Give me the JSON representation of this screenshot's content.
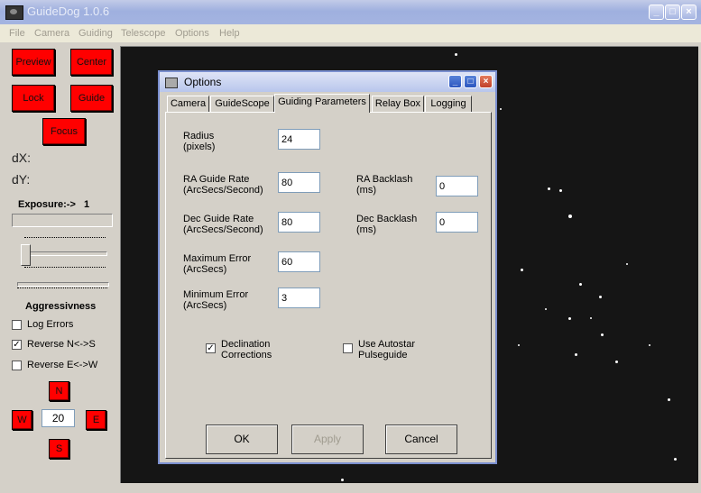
{
  "app": {
    "title": "GuideDog 1.0.6"
  },
  "menu": [
    "File",
    "Camera",
    "Guiding",
    "Telescope",
    "Options",
    "Help"
  ],
  "panel": {
    "buttons": {
      "preview": "Preview",
      "center": "Center",
      "lock": "Lock",
      "guide": "Guide",
      "focus": "Focus"
    },
    "dx_label": "dX:",
    "dy_label": "dY:",
    "exposure_label": "Exposure:->",
    "exposure_value": "1",
    "aggressiveness_label": "Aggressivness",
    "log_errors": {
      "label": "Log Errors",
      "checked": false
    },
    "reverse_ns": {
      "label": "Reverse N<->S",
      "checked": true
    },
    "reverse_ew": {
      "label": "Reverse E<->W",
      "checked": false
    },
    "nudge": {
      "n": "N",
      "w": "W",
      "e": "E",
      "s": "S",
      "value": "20"
    }
  },
  "dialog": {
    "title": "Options",
    "tabs": [
      "Camera",
      "GuideScope",
      "Guiding Parameters",
      "Relay Box",
      "Logging"
    ],
    "active_tab": "Guiding Parameters",
    "fields": {
      "radius": {
        "label1": "Radius",
        "label2": "(pixels)",
        "value": "24"
      },
      "ra_guide_rate": {
        "label1": "RA Guide Rate",
        "label2": "(ArcSecs/Second)",
        "value": "80"
      },
      "dec_guide_rate": {
        "label1": "Dec Guide Rate",
        "label2": "(ArcSecs/Second)",
        "value": "80"
      },
      "maximum_error": {
        "label1": "Maximum Error",
        "label2": "(ArcSecs)",
        "value": "60"
      },
      "minimum_error": {
        "label1": "Minimum Error",
        "label2": "(ArcSecs)",
        "value": "3"
      },
      "ra_backlash": {
        "label1": "RA Backlash",
        "label2": "(ms)",
        "value": "0"
      },
      "dec_backlash": {
        "label1": "Dec Backlash",
        "label2": "(ms)",
        "value": "0"
      }
    },
    "declination_corrections": {
      "label1": "Declination",
      "label2": "Corrections",
      "checked": true
    },
    "use_autostar": {
      "label1": "Use Autostar",
      "label2": "Pulseguide",
      "checked": false
    },
    "buttons": {
      "ok": "OK",
      "apply": "Apply",
      "cancel": "Cancel"
    }
  }
}
